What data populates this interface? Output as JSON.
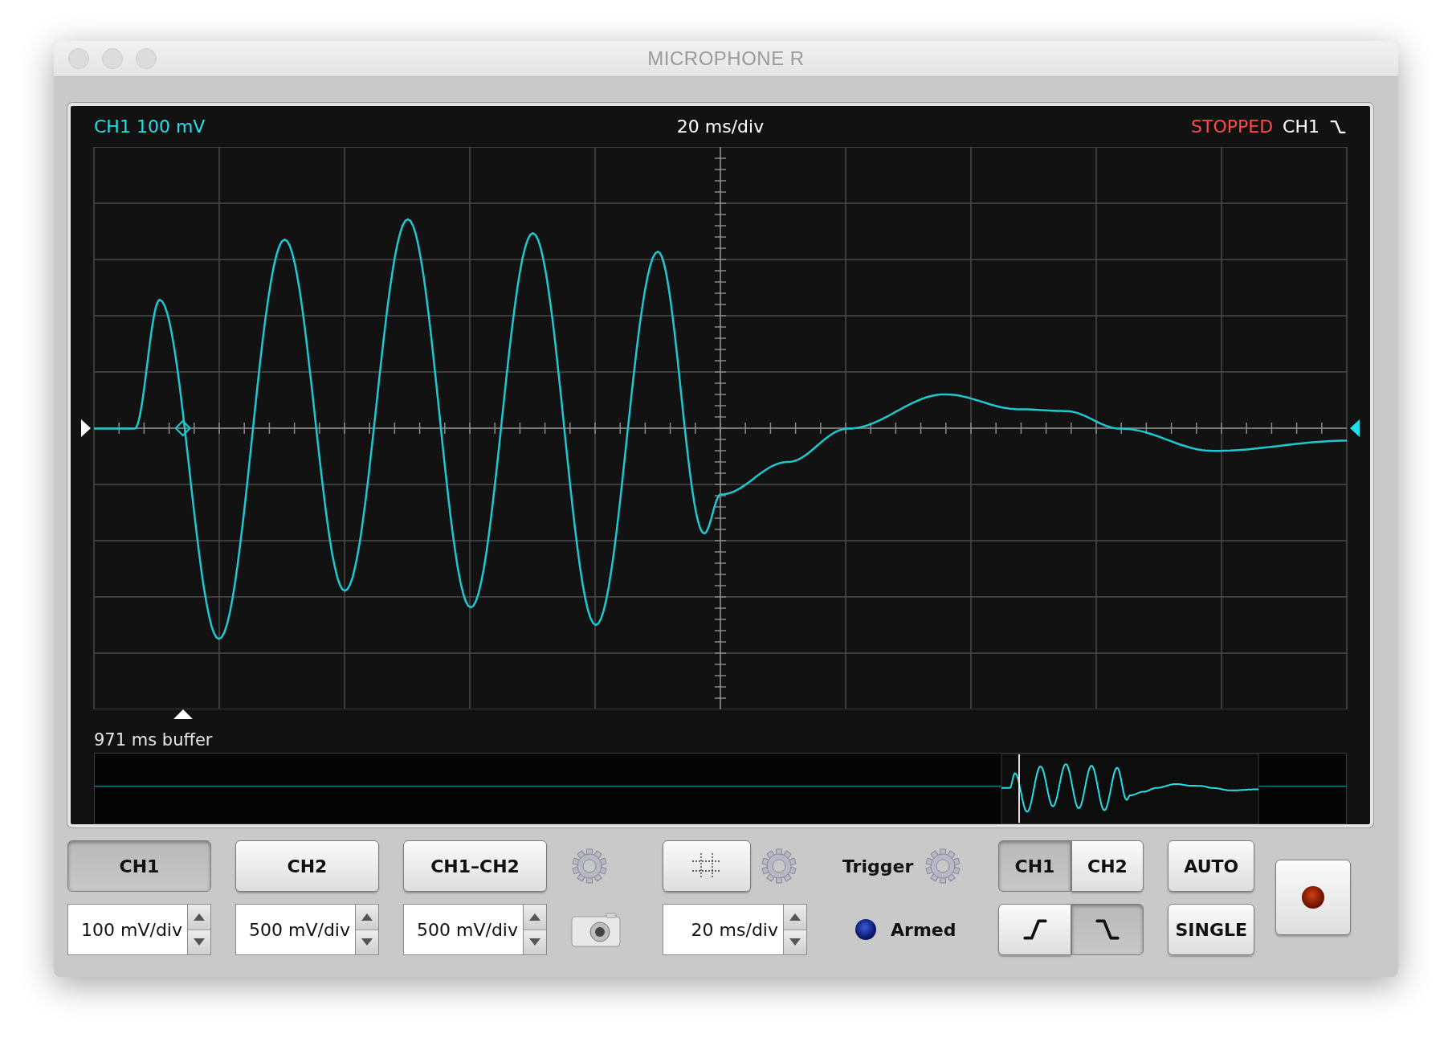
{
  "window": {
    "title": "MICROPHONE R"
  },
  "scope": {
    "channel_scale": "CH1 100 mV",
    "timebase": "20 ms/div",
    "status": "STOPPED",
    "trigger_channel": "CH1",
    "buffer_label": "971 ms buffer"
  },
  "channels": [
    {
      "label": "CH1",
      "selected": true,
      "scale": "100 mV/div"
    },
    {
      "label": "CH2",
      "selected": false,
      "scale": "500 mV/div"
    },
    {
      "label": "CH1–CH2",
      "selected": false,
      "scale": "500 mV/div"
    }
  ],
  "timebase_field": "20 ms/div",
  "trigger": {
    "label": "Trigger",
    "armed_label": "Armed",
    "armed": true,
    "sources": [
      {
        "label": "CH1",
        "selected": true
      },
      {
        "label": "CH2",
        "selected": false
      }
    ],
    "slopes": [
      {
        "kind": "rising",
        "selected": false
      },
      {
        "kind": "falling",
        "selected": true
      }
    ]
  },
  "modes": [
    "AUTO",
    "SINGLE"
  ]
}
